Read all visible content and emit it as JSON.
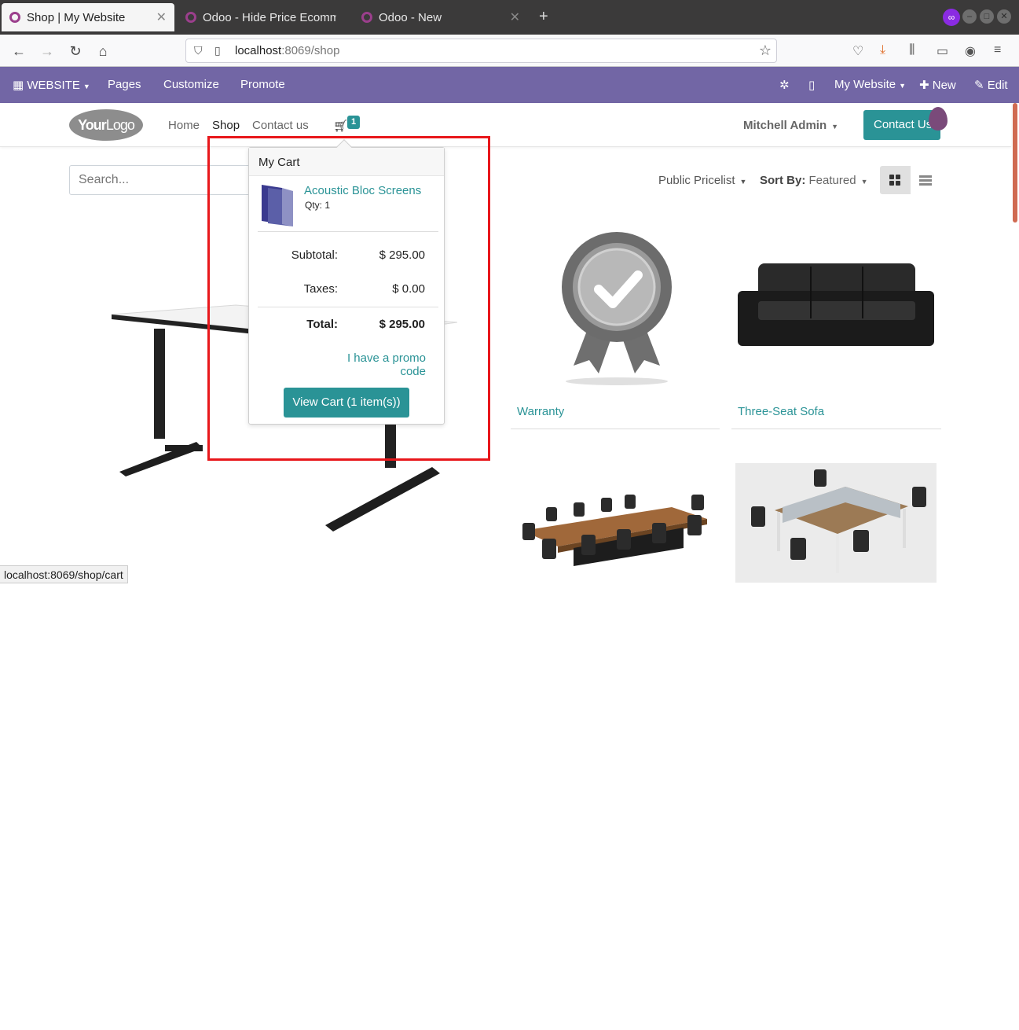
{
  "browser": {
    "tabs": [
      {
        "label": "Shop | My Website",
        "active": true
      },
      {
        "label": "Odoo - Hide Price Ecomm",
        "active": false
      },
      {
        "label": "Odoo - New",
        "active": false
      }
    ],
    "new_tab": "+",
    "url_host": "localhost",
    "url_rest": ":8069/shop",
    "status_url": "localhost:8069/shop/cart"
  },
  "odoo_bar": {
    "apps_label": "WEBSITE",
    "pages": "Pages",
    "customize": "Customize",
    "promote": "Promote",
    "website_switcher": "My Website",
    "new": "New",
    "edit": "Edit"
  },
  "site_header": {
    "logo_bold": "Your",
    "logo_rest": "Logo",
    "menu": [
      "Home",
      "Shop",
      "Contact us"
    ],
    "cart_count": "1",
    "user": "Mitchell Admin",
    "contact_button": "Contact Us"
  },
  "toolbar": {
    "search_placeholder": "Search...",
    "pricelist": "Public Pricelist",
    "sort_label": "Sort By:",
    "sort_value": "Featured"
  },
  "products": [
    {
      "name": "Warranty"
    },
    {
      "name": "Three-Seat Sofa"
    }
  ],
  "cart_popover": {
    "title": "My Cart",
    "item_name": "Acoustic Bloc Screens",
    "item_qty": "Qty: 1",
    "subtotal_label": "Subtotal:",
    "subtotal_value": "$ 295.00",
    "taxes_label": "Taxes:",
    "taxes_value": "$ 0.00",
    "total_label": "Total:",
    "total_value": "$ 295.00",
    "promo_link": "I have a promo code",
    "view_cart_button": "View Cart (1 item(s))"
  },
  "colors": {
    "odoo_purple": "#7266a5",
    "accent_teal": "#2a9396",
    "highlight_red": "#e8171b"
  }
}
